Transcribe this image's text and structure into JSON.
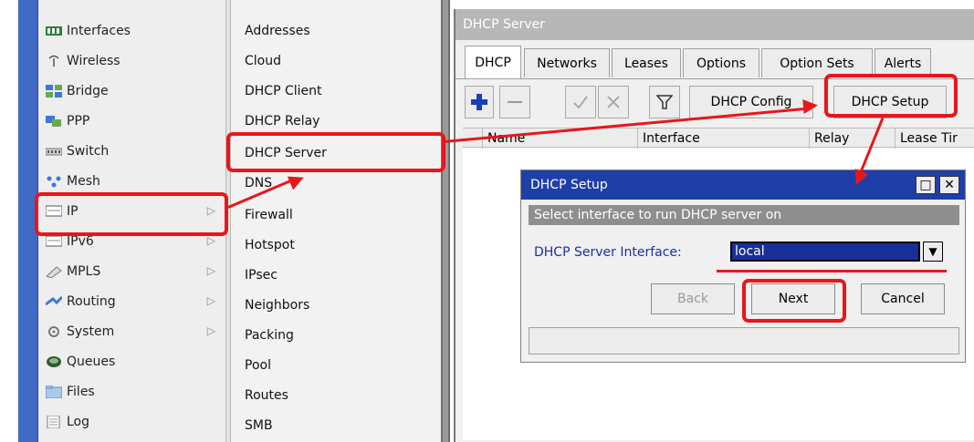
{
  "main_menu": {
    "items": [
      {
        "label": "Interfaces",
        "icon": "interfaces-icon",
        "has_arrow": false
      },
      {
        "label": "Wireless",
        "icon": "wireless-icon",
        "has_arrow": false
      },
      {
        "label": "Bridge",
        "icon": "bridge-icon",
        "has_arrow": false
      },
      {
        "label": "PPP",
        "icon": "ppp-icon",
        "has_arrow": false
      },
      {
        "label": "Switch",
        "icon": "switch-icon",
        "has_arrow": false
      },
      {
        "label": "Mesh",
        "icon": "mesh-icon",
        "has_arrow": false
      },
      {
        "label": "IP",
        "icon": "ip-icon",
        "has_arrow": true
      },
      {
        "label": "IPv6",
        "icon": "ipv6-icon",
        "has_arrow": true
      },
      {
        "label": "MPLS",
        "icon": "mpls-icon",
        "has_arrow": true
      },
      {
        "label": "Routing",
        "icon": "routing-icon",
        "has_arrow": true
      },
      {
        "label": "System",
        "icon": "system-icon",
        "has_arrow": true
      },
      {
        "label": "Queues",
        "icon": "queues-icon",
        "has_arrow": false
      },
      {
        "label": "Files",
        "icon": "files-icon",
        "has_arrow": false
      },
      {
        "label": "Log",
        "icon": "log-icon",
        "has_arrow": false
      }
    ]
  },
  "ip_submenu": {
    "items": [
      "Addresses",
      "Cloud",
      "DHCP Client",
      "DHCP Relay",
      "DHCP Server",
      "DNS",
      "Firewall",
      "Hotspot",
      "IPsec",
      "Neighbors",
      "Packing",
      "Pool",
      "Routes",
      "SMB"
    ]
  },
  "dhcp_server_window": {
    "title": "DHCP Server",
    "tabs": [
      "DHCP",
      "Networks",
      "Leases",
      "Options",
      "Option Sets",
      "Alerts"
    ],
    "active_tab": "DHCP",
    "toolbar": {
      "add_icon": "plus-icon",
      "remove_icon": "minus-icon",
      "enable_icon": "check-icon",
      "disable_icon": "cross-icon",
      "filter_icon": "filter-icon",
      "dhcp_config_label": "DHCP Config",
      "dhcp_setup_label": "DHCP Setup"
    },
    "columns": [
      "Name",
      "Interface",
      "Relay",
      "Lease Tir"
    ]
  },
  "dhcp_setup_dialog": {
    "title": "DHCP Setup",
    "restore_icon": "restore-icon",
    "close_icon": "close-icon",
    "message": "Select interface to run DHCP server on",
    "field_label": "DHCP Server Interface:",
    "field_value": "local",
    "buttons": {
      "back": "Back",
      "next": "Next",
      "cancel": "Cancel"
    }
  },
  "colors": {
    "annotation_red": "#e8161b",
    "dialog_title_blue": "#1f3fa8",
    "label_blue": "#1b2fa6",
    "strip_blue": "#4169c6"
  }
}
